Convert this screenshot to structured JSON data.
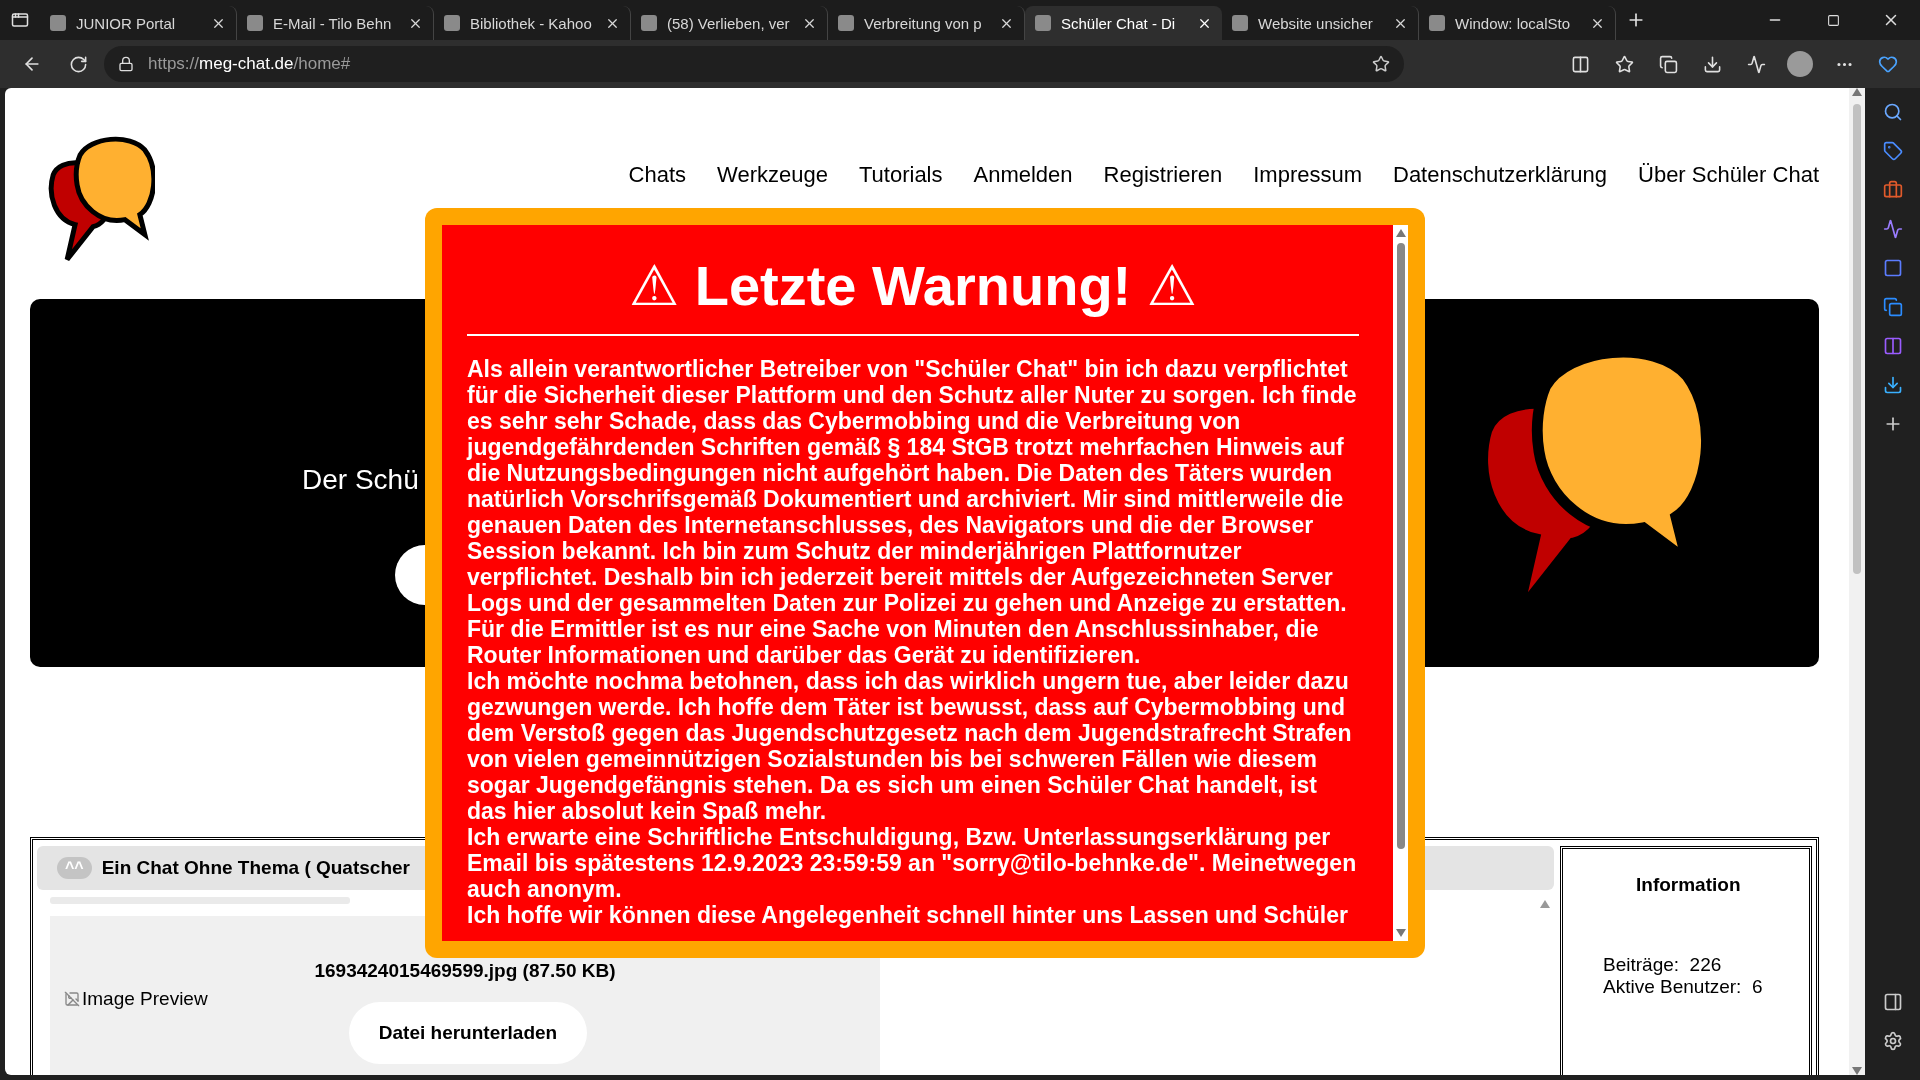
{
  "browser": {
    "tabs": [
      {
        "title": "JUNIOR Portal",
        "selected": false
      },
      {
        "title": "E-Mail - Tilo Behn",
        "selected": false
      },
      {
        "title": "Bibliothek - Kahoo",
        "selected": false
      },
      {
        "title": "(58) Verlieben, ver",
        "selected": false
      },
      {
        "title": "Verbreitung von p",
        "selected": false
      },
      {
        "title": "Schüler Chat - Di",
        "selected": true
      },
      {
        "title": "Website unsicher",
        "selected": false
      },
      {
        "title": "Window: localSto",
        "selected": false
      }
    ],
    "address": {
      "scheme": "https://",
      "host": "meg-chat.de",
      "path": "/home#"
    }
  },
  "site": {
    "nav": [
      "Chats",
      "Werkzeuge",
      "Tutorials",
      "Anmelden",
      "Registrieren",
      "Impressum",
      "Datenschutzerklärung",
      "Über Schüler Chat"
    ],
    "hero": {
      "text": "Der Schü"
    },
    "chat": {
      "avatar": "^^",
      "title": "Ein Chat Ohne Thema ( Quatscher",
      "file_name": "1693424015469599.jpg (87.50 KB)",
      "image_alt": "Image Preview",
      "download_button": "Datei herunterladen"
    },
    "info": {
      "title": "Information",
      "stats": [
        {
          "label": "Beiträge:",
          "value": "226"
        },
        {
          "label": "Aktive Benutzer:",
          "value": "6"
        }
      ]
    }
  },
  "modal": {
    "title": "⚠ Letzte Warnung! ⚠",
    "paragraphs": [
      "Als allein verantwortlicher Betreiber von \"Schüler Chat\" bin ich dazu verpflichtet für die Sicherheit dieser Plattform und den Schutz aller Nuter zu sorgen. Ich finde es sehr sehr Schade, dass das Cybermobbing und die Verbreitung von jugendgefährdenden Schriften gemäß § 184 StGB trotzt mehrfachen Hinweis auf die Nutzungsbedingungen nicht aufgehört haben. Die Daten des Täters wurden natürlich Vorschrifsgemäß Dokumentiert und archiviert. Mir sind mittlerweile die genauen Daten des Internetanschlusses, des Navigators und die der Browser Session bekannt. Ich bin zum Schutz der minderjährigen Plattfornutzer verpflichtet. Deshalb bin ich jederzeit bereit mittels der Aufgezeichneten Server Logs und der gesammelten Daten zur Polizei zu gehen und Anzeige zu erstatten. Für die Ermittler ist es nur eine Sache von Minuten den Anschlussinhaber, die Router Informationen und darüber das Gerät zu identifizieren.",
      "Ich möchte nochma betohnen, dass ich das wirklich ungern tue, aber leider dazu gezwungen werde. Ich hoffe dem Täter ist bewusst, dass auf Cybermobbing und dem Verstoß gegen das Jugendschutzgesetz nach dem Jugendstrafrecht Strafen von vielen gemeinnützigen Sozialstunden bis bei schweren Fällen wie diesem sogar Jugendgefängnis stehen. Da es sich um einen Schüler Chat handelt, ist das hier absolut kein Spaß mehr.",
      "Ich erwarte eine Schriftliche Entschuldigung, Bzw. Unterlassungserklärung per Email bis spätestens 12.9.2023 23:59:59 an \"sorry@tilo-behnke.de\". Meinetwegen auch anonym.",
      "Ich hoffe wir können diese Angelegenheit schnell hinter uns Lassen und Schüler"
    ]
  }
}
